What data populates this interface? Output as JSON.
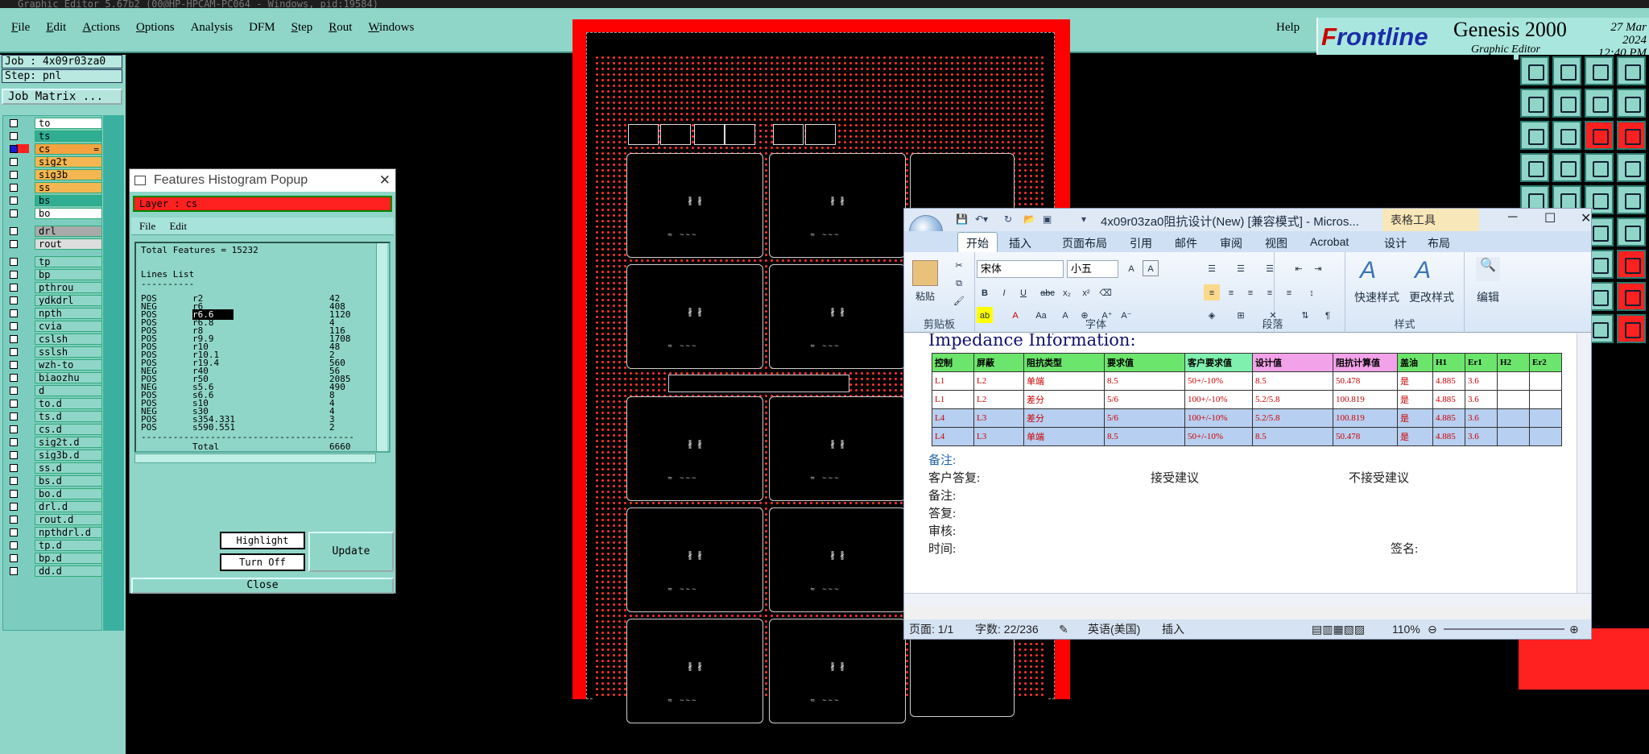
{
  "window": {
    "title": "Graphic Editor 5.67b2 (00@HP-HPCAM-PC064 - Windows, pid:19584)"
  },
  "menubar": {
    "items": [
      {
        "label": "File",
        "ul": "F",
        "rest": "ile"
      },
      {
        "label": "Edit",
        "ul": "E",
        "rest": "dit"
      },
      {
        "label": "Actions",
        "ul": "A",
        "rest": "ctions"
      },
      {
        "label": "Options",
        "ul": "O",
        "rest": "ptions"
      },
      {
        "label": "Analysis",
        "ul": "",
        "rest": "Analysis"
      },
      {
        "label": "DFM",
        "ul": "",
        "rest": "DFM"
      },
      {
        "label": "Step",
        "ul": "S",
        "rest": "tep"
      },
      {
        "label": "Rout",
        "ul": "R",
        "rest": "out"
      },
      {
        "label": "Windows",
        "ul": "W",
        "rest": "indows"
      }
    ],
    "help": "Help"
  },
  "brand": {
    "logo_a": "F",
    "logo_b": "rontline",
    "product": "Genesis 2000",
    "subtitle": "Graphic Editor",
    "date": "27 Mar 2024",
    "time": "12:40 PM"
  },
  "job": {
    "job_line": "Job : 4x09r03za0",
    "step_line": "Step: pnl",
    "job_matrix": "Job Matrix ..."
  },
  "layers": [
    {
      "name": "to",
      "color": "#ffffff"
    },
    {
      "name": "ts",
      "color": "#2fae93"
    },
    {
      "name": "cs",
      "color": "#f4a340",
      "selected": true
    },
    {
      "name": "sig2t",
      "color": "#f4b650"
    },
    {
      "name": "sig3b",
      "color": "#f4b650"
    },
    {
      "name": "ss",
      "color": "#f4b650"
    },
    {
      "name": "bs",
      "color": "#2fae93"
    },
    {
      "name": "bo",
      "color": "#ffffff"
    },
    {
      "name": "drl",
      "color": "#aaaaaa"
    },
    {
      "name": "rout",
      "color": "#dddddd"
    },
    {
      "name": "tp",
      "color": "#8fd6c8"
    },
    {
      "name": "bp",
      "color": "#8fd6c8"
    },
    {
      "name": "pthrou",
      "color": "#8fd6c8"
    },
    {
      "name": "ydkdrl",
      "color": "#8fd6c8"
    },
    {
      "name": "npth",
      "color": "#8fd6c8"
    },
    {
      "name": "cvia",
      "color": "#8fd6c8"
    },
    {
      "name": "cslsh",
      "color": "#8fd6c8"
    },
    {
      "name": "sslsh",
      "color": "#8fd6c8"
    },
    {
      "name": "wzh-to",
      "color": "#8fd6c8"
    },
    {
      "name": "biaozhu",
      "color": "#8fd6c8"
    },
    {
      "name": "d",
      "color": "#8fd6c8"
    },
    {
      "name": "to.d",
      "color": "#8fd6c8"
    },
    {
      "name": "ts.d",
      "color": "#8fd6c8"
    },
    {
      "name": "cs.d",
      "color": "#8fd6c8"
    },
    {
      "name": "sig2t.d",
      "color": "#8fd6c8"
    },
    {
      "name": "sig3b.d",
      "color": "#8fd6c8"
    },
    {
      "name": "ss.d",
      "color": "#8fd6c8"
    },
    {
      "name": "bs.d",
      "color": "#8fd6c8"
    },
    {
      "name": "bo.d",
      "color": "#8fd6c8"
    },
    {
      "name": "drl.d",
      "color": "#8fd6c8"
    },
    {
      "name": "rout.d",
      "color": "#8fd6c8"
    },
    {
      "name": "npthdrl.d",
      "color": "#8fd6c8"
    },
    {
      "name": "tp.d",
      "color": "#8fd6c8"
    },
    {
      "name": "bp.d",
      "color": "#8fd6c8"
    },
    {
      "name": "dd.d",
      "color": "#8fd6c8"
    }
  ],
  "histogram": {
    "title": "Features Histogram Popup",
    "layer": "Layer :  cs",
    "menu": [
      "File",
      "Edit"
    ],
    "total_features": "Total Features = 15232",
    "section": "Lines List",
    "underline": "----------",
    "rows": [
      {
        "pol": "POS",
        "sym": "r2",
        "count": "42"
      },
      {
        "pol": "NEG",
        "sym": "r6",
        "count": "408"
      },
      {
        "pol": "POS",
        "sym": "r6.6",
        "count": "1120",
        "highlight": true
      },
      {
        "pol": "POS",
        "sym": "r6.8",
        "count": "4"
      },
      {
        "pol": "POS",
        "sym": "r8",
        "count": "116"
      },
      {
        "pol": "POS",
        "sym": "r9.9",
        "count": "1708"
      },
      {
        "pol": "POS",
        "sym": "r10",
        "count": "48"
      },
      {
        "pol": "POS",
        "sym": "r10.1",
        "count": "2"
      },
      {
        "pol": "POS",
        "sym": "r19.4",
        "count": "560"
      },
      {
        "pol": "NEG",
        "sym": "r40",
        "count": "56"
      },
      {
        "pol": "POS",
        "sym": "r50",
        "count": "2085"
      },
      {
        "pol": "NEG",
        "sym": "s5.6",
        "count": "490"
      },
      {
        "pol": "POS",
        "sym": "s6.6",
        "count": "8"
      },
      {
        "pol": "POS",
        "sym": "s10",
        "count": "4"
      },
      {
        "pol": "NEG",
        "sym": "s30",
        "count": "4"
      },
      {
        "pol": "POS",
        "sym": "s354.331",
        "count": "3"
      },
      {
        "pol": "POS",
        "sym": "s590.551",
        "count": "2"
      }
    ],
    "divider": "----------------------------------------",
    "total_label": "Total",
    "total_count": "6660",
    "btn_highlight": "Highlight",
    "btn_turnoff": "Turn Off",
    "btn_update": "Update",
    "btn_close": "Close"
  },
  "word": {
    "title": "4x09r03za0阻抗设计(New) [兼容模式] - Micros...",
    "table_tools": "表格工具",
    "tabs": [
      "开始",
      "插入",
      "页面布局",
      "引用",
      "邮件",
      "审阅",
      "视图",
      "Acrobat",
      "设计",
      "布局"
    ],
    "ribbon": {
      "paste": "粘贴",
      "clipboard": "剪贴板",
      "font_name": "宋体",
      "font_size": "小五",
      "font_group": "字体",
      "paragraph": "段落",
      "quick_style": "快速样式",
      "change_style": "更改样式",
      "styles": "样式",
      "edit": "编辑"
    },
    "doc": {
      "heading": "Impedance Information:",
      "table_headers": [
        "控制",
        "屏蔽",
        "阻抗类型",
        "要求值",
        "客户要求值",
        "设计值",
        "阻抗计算值",
        "盖油",
        "H1",
        "Er1",
        "H2",
        "Er2"
      ],
      "table_rows": [
        [
          "L1",
          "L2",
          "单端",
          "8.5",
          "50+/-10%",
          "8.5",
          "50.478",
          "是",
          "4.885",
          "3.6",
          "",
          ""
        ],
        [
          "L1",
          "L2",
          "差分",
          "5/6",
          "100+/-10%",
          "5.2/5.8",
          "100.819",
          "是",
          "4.885",
          "3.6",
          "",
          ""
        ],
        [
          "L4",
          "L3",
          "差分",
          "5/6",
          "100+/-10%",
          "5.2/5.8",
          "100.819",
          "是",
          "4.885",
          "3.6",
          "",
          ""
        ],
        [
          "L4",
          "L3",
          "单端",
          "8.5",
          "50+/-10%",
          "8.5",
          "50.478",
          "是",
          "4.885",
          "3.6",
          "",
          ""
        ]
      ],
      "note1": "备注:",
      "reply_label": "客户答复:",
      "accept": "接受建议",
      "reject": "不接受建议",
      "note2": "备注:",
      "answer": "答复:",
      "review": "审核:",
      "time": "时间:",
      "sign": "签名:"
    },
    "status": {
      "page": "页面: 1/1",
      "words": "字数: 22/236",
      "lang": "英语(美国)",
      "mode": "插入",
      "zoom": "110%"
    }
  }
}
